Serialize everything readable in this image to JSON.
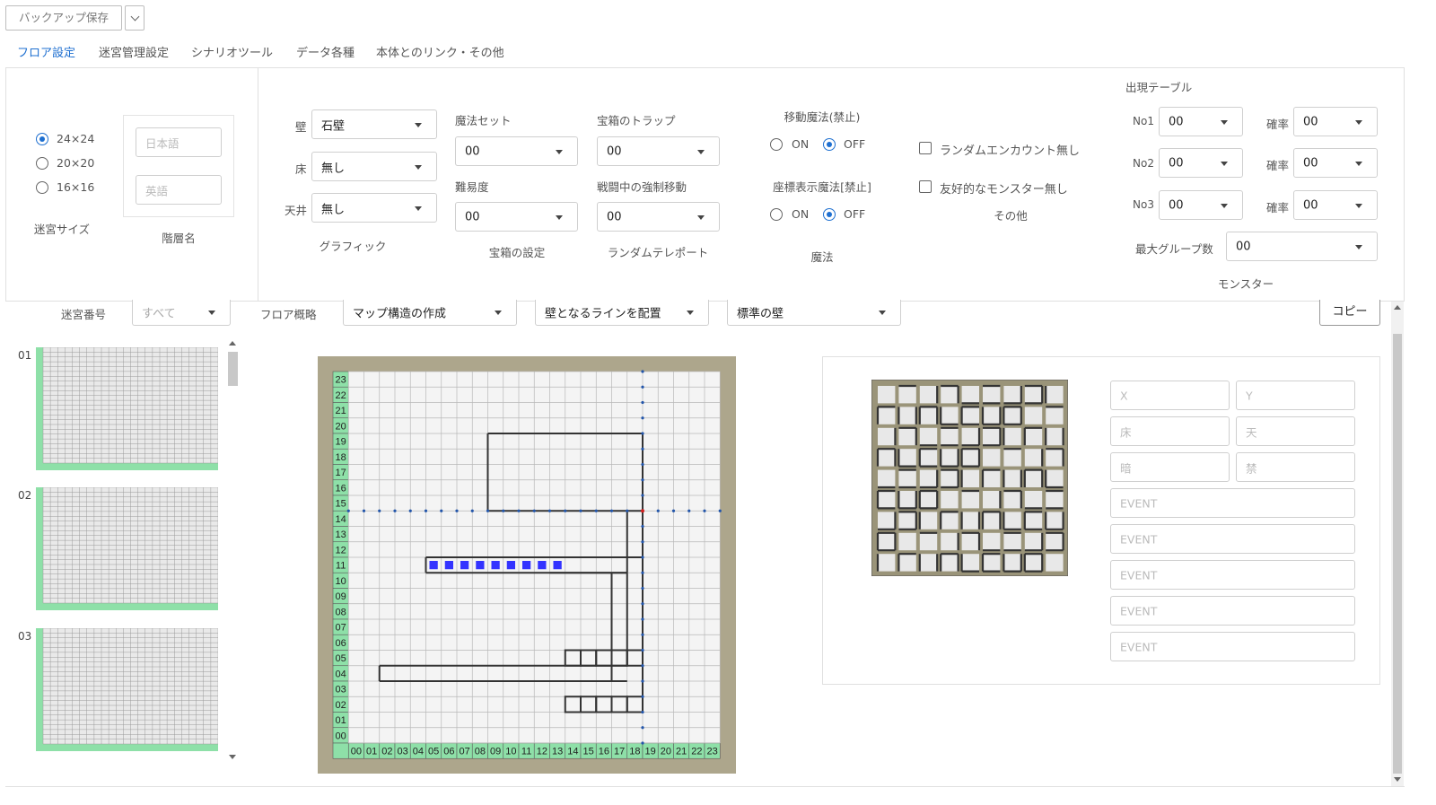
{
  "toolbar": {
    "backup_label": "バックアップ保存",
    "dropdown_icon": "chevron-down-icon"
  },
  "tabs": [
    {
      "label": "フロア設定",
      "active": true
    },
    {
      "label": "迷宮管理設定",
      "active": false
    },
    {
      "label": "シナリオツール",
      "active": false
    },
    {
      "label": "データ各種",
      "active": false
    },
    {
      "label": "本体とのリンク・その他",
      "active": false
    }
  ],
  "maze_size": {
    "caption": "迷宮サイズ",
    "options": [
      "24×24",
      "20×20",
      "16×16"
    ],
    "selected": "24×24"
  },
  "floor_name": {
    "caption": "階層名",
    "japanese_placeholder": "日本語",
    "english_placeholder": "英語"
  },
  "graphic": {
    "caption": "グラフィック",
    "wall_label": "壁",
    "wall_value": "石壁",
    "floor_label": "床",
    "floor_value": "無し",
    "ceiling_label": "天井",
    "ceiling_value": "無し"
  },
  "chest": {
    "caption": "宝箱の設定",
    "magic_set_label": "魔法セット",
    "magic_set_value": "00",
    "difficulty_label": "難易度",
    "difficulty_value": "00"
  },
  "teleport": {
    "caption": "ランダムテレポート",
    "trap_label": "宝箱のトラップ",
    "trap_value": "00",
    "forced_move_label": "戦闘中の強制移動",
    "forced_move_value": "00"
  },
  "magic": {
    "caption": "魔法",
    "move_label": "移動魔法(禁止)",
    "coord_label": "座標表示魔法[禁止]",
    "on_label": "ON",
    "off_label": "OFF",
    "move_selected": "OFF",
    "coord_selected": "OFF"
  },
  "other": {
    "caption": "その他",
    "no_random_encounter": "ランダムエンカウント無し",
    "no_friendly_monster": "友好的なモンスター無し"
  },
  "monster": {
    "caption": "モンスター",
    "table_title": "出現テーブル",
    "rows": [
      {
        "label": "No1",
        "value": "00",
        "rate_label": "確率",
        "rate": "00"
      },
      {
        "label": "No2",
        "value": "00",
        "rate_label": "確率",
        "rate": "00"
      },
      {
        "label": "No3",
        "value": "00",
        "rate_label": "確率",
        "rate": "00"
      }
    ],
    "max_group_label": "最大グループ数",
    "max_group_value": "00"
  },
  "filter": {
    "maze_number_label": "迷宮番号",
    "maze_number_value": "すべて",
    "floor_overview_label": "フロア概略",
    "mode_value": "マップ構造の作成",
    "place_value": "壁となるラインを配置",
    "wall_type_value": "標準の壁",
    "copy_label": "コピー"
  },
  "floor_list": [
    "01",
    "02",
    "03"
  ],
  "map": {
    "row_labels": [
      "23",
      "22",
      "21",
      "20",
      "19",
      "18",
      "17",
      "16",
      "15",
      "14",
      "13",
      "12",
      "11",
      "10",
      "09",
      "08",
      "07",
      "06",
      "05",
      "04",
      "03",
      "02",
      "01",
      "00"
    ],
    "col_labels": [
      "00",
      "01",
      "02",
      "03",
      "04",
      "05",
      "06",
      "07",
      "08",
      "09",
      "10",
      "11",
      "12",
      "13",
      "14",
      "15",
      "16",
      "17",
      "18",
      "19",
      "20",
      "21",
      "22",
      "23"
    ]
  },
  "cell_info": {
    "x_placeholder": "X",
    "y_placeholder": "Y",
    "floor_placeholder": "床",
    "ceiling_placeholder": "天",
    "dark_placeholder": "暗",
    "forbid_placeholder": "禁",
    "events": [
      "EVENT",
      "EVENT",
      "EVENT",
      "EVENT",
      "EVENT"
    ]
  },
  "colors": {
    "accent": "#1e6fd0",
    "map_frame": "#ada68c",
    "label_green": "#8ee0a8",
    "marker_blue": "#3333ff"
  }
}
